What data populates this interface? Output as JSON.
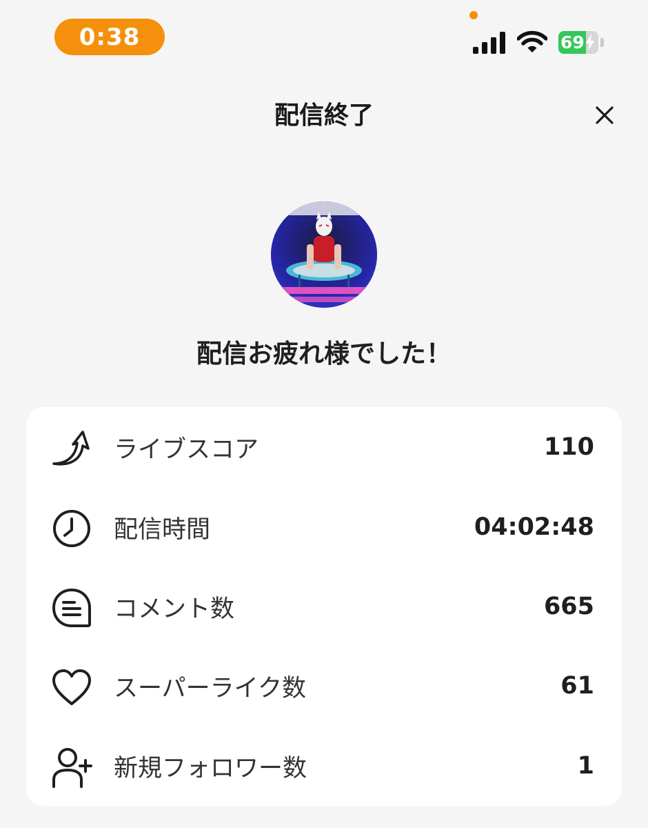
{
  "status_bar": {
    "time": "0:38",
    "battery_level": "69",
    "battery_percent": 69,
    "accent_color": "#f4900c",
    "battery_color": "#34c759"
  },
  "header": {
    "title": "配信終了",
    "close_icon": "close-icon"
  },
  "avatar": {
    "icon": "avatar"
  },
  "message": "配信お疲れ様でした！",
  "stats": [
    {
      "icon": "arrow-up-icon",
      "label": "ライブスコア",
      "value": "110"
    },
    {
      "icon": "clock-icon",
      "label": "配信時間",
      "value": "04:02:48"
    },
    {
      "icon": "comment-icon",
      "label": "コメント数",
      "value": "665"
    },
    {
      "icon": "heart-icon",
      "label": "スーパーライク数",
      "value": "61"
    },
    {
      "icon": "add-user-icon",
      "label": "新規フォロワー数",
      "value": "1"
    }
  ]
}
